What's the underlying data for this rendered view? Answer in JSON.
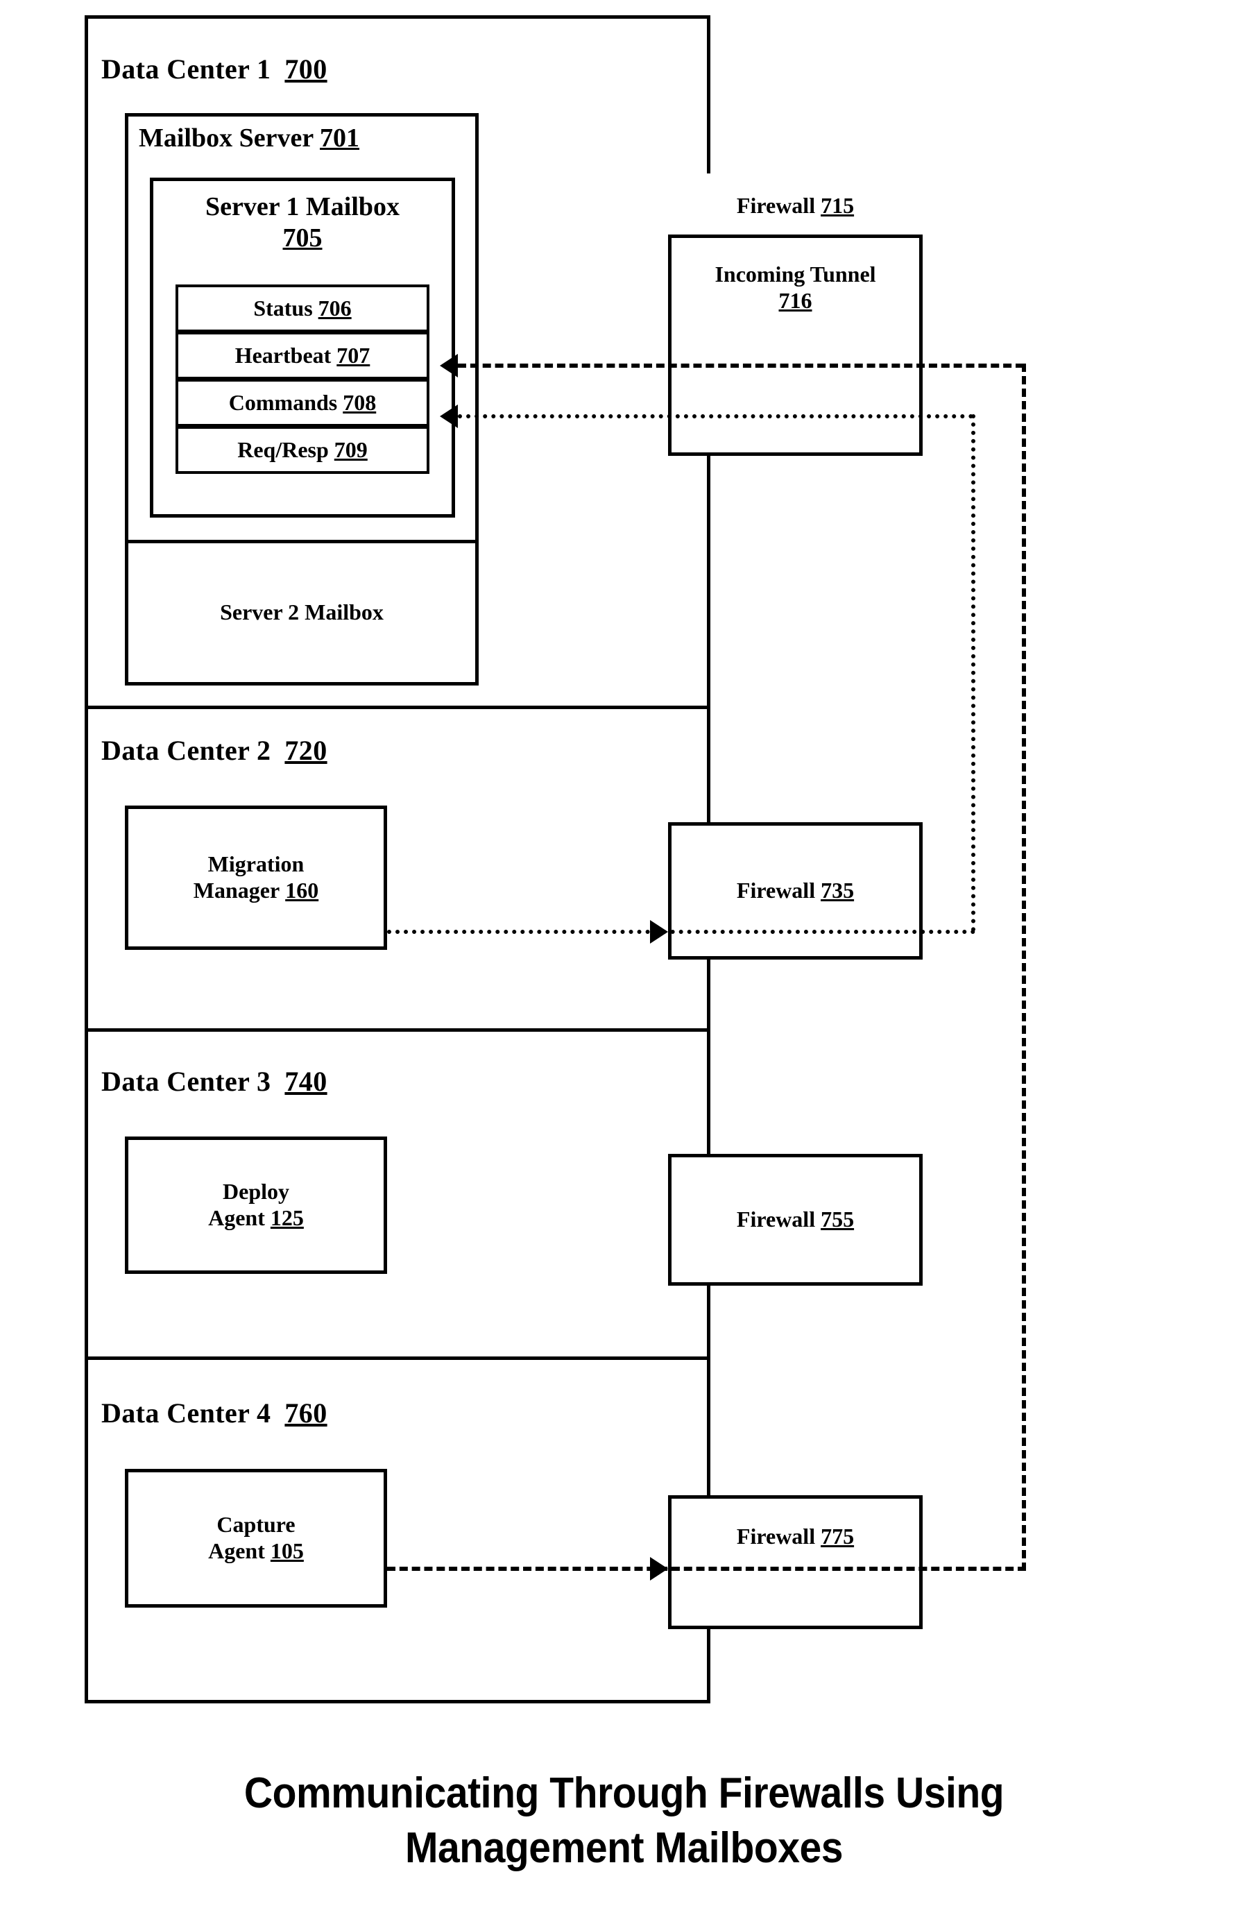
{
  "caption": {
    "line1": "Communicating Through Firewalls Using",
    "line2": "Management Mailboxes"
  },
  "data_centers": [
    {
      "id": "dc1",
      "title": "Data Center 1",
      "ref": "700",
      "mailbox_server": {
        "title": "Mailbox Server",
        "ref": "701",
        "server1_mailbox": {
          "title_line1": "Server 1 Mailbox",
          "ref": "705",
          "slots": [
            {
              "label": "Status",
              "ref": "706"
            },
            {
              "label": "Heartbeat",
              "ref": "707"
            },
            {
              "label": "Commands",
              "ref": "708"
            },
            {
              "label": "Req/Resp",
              "ref": "709"
            }
          ]
        },
        "server2_mailbox": {
          "label": "Server 2 Mailbox",
          "ref": ""
        }
      },
      "firewall": {
        "title": "Firewall",
        "ref": "715",
        "tunnel_line1": "Incoming Tunnel",
        "tunnel_ref": "716"
      }
    },
    {
      "id": "dc2",
      "title": "Data Center 2",
      "ref": "720",
      "component": {
        "line1": "Migration",
        "line2": "Manager",
        "ref": "160"
      },
      "firewall": {
        "title": "Firewall",
        "ref": "735"
      }
    },
    {
      "id": "dc3",
      "title": "Data Center 3",
      "ref": "740",
      "component": {
        "line1": "Deploy",
        "line2": "Agent",
        "ref": "125"
      },
      "firewall": {
        "title": "Firewall",
        "ref": "755"
      }
    },
    {
      "id": "dc4",
      "title": "Data Center 4",
      "ref": "760",
      "component": {
        "line1": "Capture",
        "line2": "Agent",
        "ref": "105"
      },
      "firewall": {
        "title": "Firewall",
        "ref": "775"
      }
    }
  ],
  "connections": {
    "heartbeat_path": "dashed",
    "commands_path": "dotted",
    "capture_to_firewall775": "dashed",
    "migration_to_firewall735": "dotted"
  },
  "colors": {
    "stroke": "#000000",
    "background": "#ffffff"
  }
}
